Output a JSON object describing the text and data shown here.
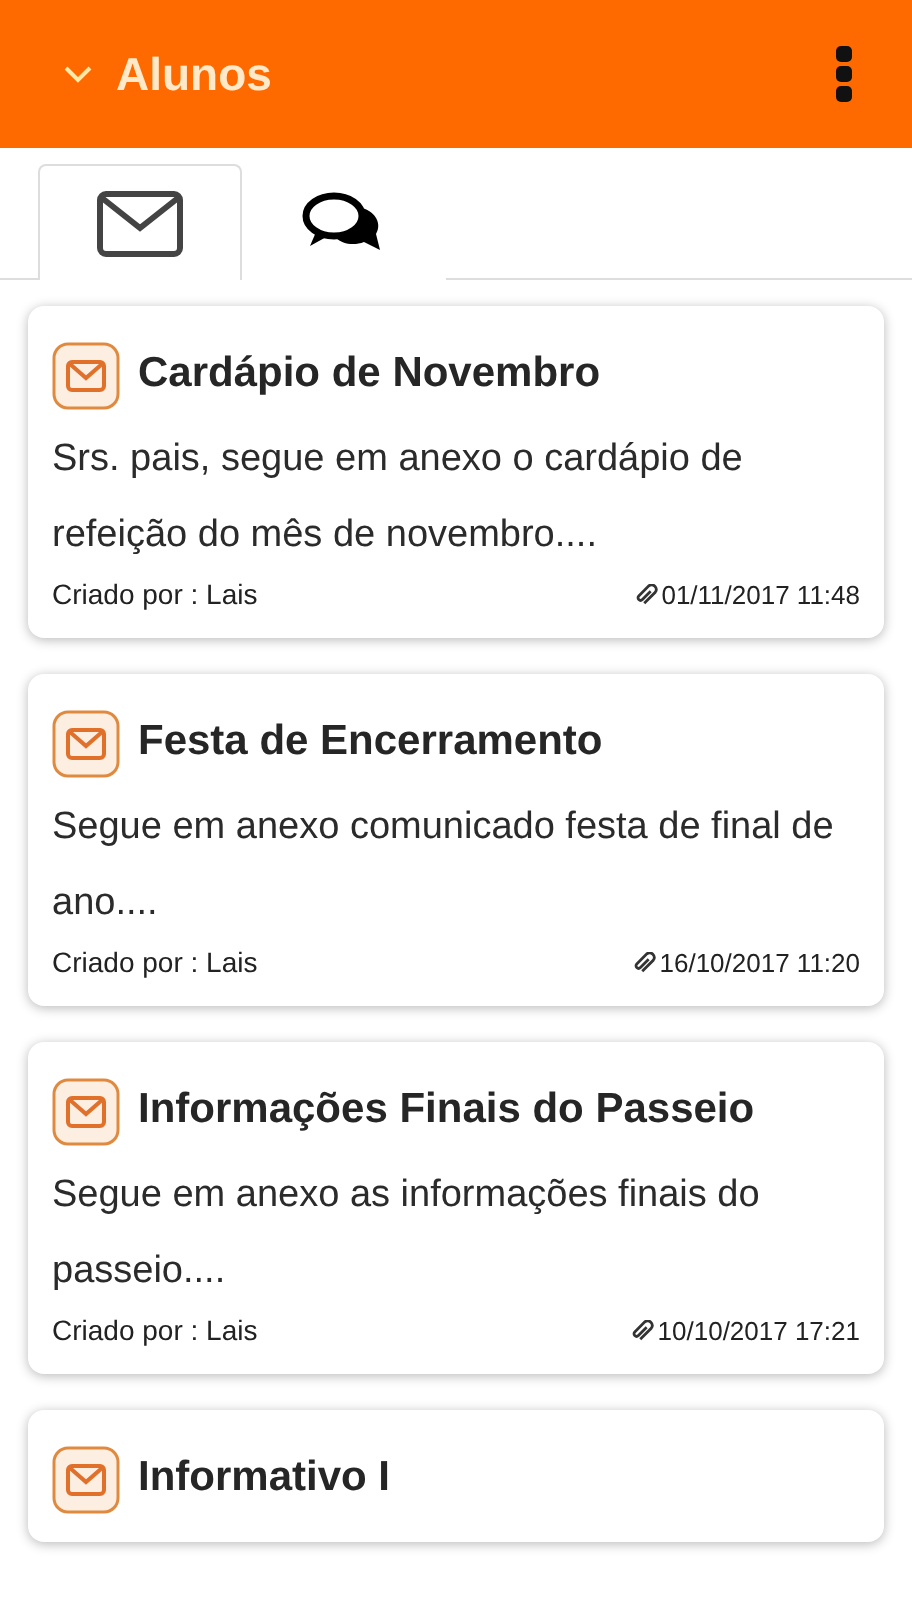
{
  "header": {
    "title": "Alunos"
  },
  "tabs": [
    {
      "kind": "messages",
      "selected": true
    },
    {
      "kind": "chat",
      "selected": false
    }
  ],
  "messages": [
    {
      "title": "Cardápio de Novembro",
      "body": "Srs. pais,   segue em anexo o cardápio de refeição do mês de novembro....",
      "author": "Criado por : Lais",
      "date": "01/11/2017 11:48"
    },
    {
      "title": "Festa de Encerramento",
      "body": "Segue em anexo comunicado festa de final de ano....",
      "author": "Criado por : Lais",
      "date": "16/10/2017 11:20"
    },
    {
      "title": "Informações Finais do Passeio",
      "body": "Segue em anexo as informações finais do passeio....",
      "author": "Criado por : Lais",
      "date": "10/10/2017 17:21"
    },
    {
      "title": "Informativo I"
    }
  ]
}
